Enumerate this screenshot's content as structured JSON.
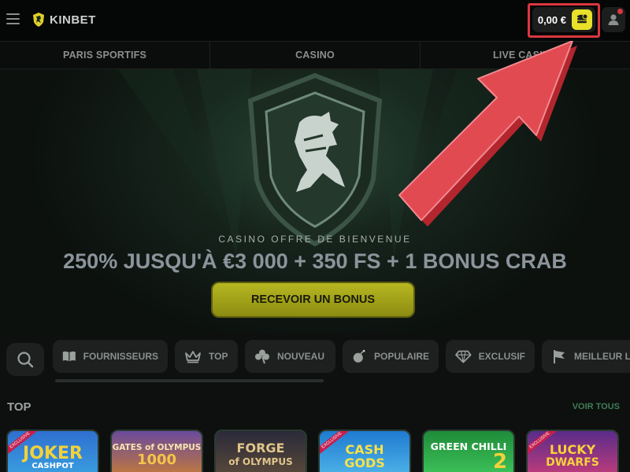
{
  "header": {
    "logo_text": "KINBET",
    "balance": "0,00 €"
  },
  "nav": {
    "items": [
      {
        "label": "PARIS SPORTIFS"
      },
      {
        "label": "CASINO"
      },
      {
        "label": "LIVE CASINO"
      }
    ]
  },
  "hero": {
    "kicker": "CASINO OFFRE DE BIENVENUE",
    "title": "250% JUSQU'À €3 000 + 350 FS + 1 BONUS CRAB",
    "cta_label": "RECEVOIR UN BONUS"
  },
  "filters": {
    "chips": [
      {
        "label": "FOURNISSEURS",
        "icon": "book-icon"
      },
      {
        "label": "TOP",
        "icon": "crown-icon"
      },
      {
        "label": "NOUVEAU",
        "icon": "clover-icon"
      },
      {
        "label": "POPULAIRE",
        "icon": "bomb-icon"
      },
      {
        "label": "EXCLUSIF",
        "icon": "diamond-icon"
      },
      {
        "label": "MEILLEUR L",
        "icon": "flag-icon"
      }
    ]
  },
  "top_section": {
    "title": "TOP",
    "see_all": "VOIR TOUS"
  },
  "games": [
    {
      "title": "JOKER",
      "subtitle": "CASHPOT",
      "tag": "EXCLUSIVE"
    },
    {
      "title": "GATES of OLYMPUS",
      "subtitle": "1000",
      "tag": ""
    },
    {
      "title": "FORGE",
      "subtitle": "of OLYMPUS",
      "tag": ""
    },
    {
      "title": "CASH",
      "subtitle": "GODS",
      "tag": "EXCLUSIVE"
    },
    {
      "title": "GREEN CHILLI",
      "subtitle": "2",
      "tag": ""
    },
    {
      "title": "LUCKY",
      "subtitle": "DWARFS",
      "tag": "EXCLUSIVE"
    }
  ],
  "colors": {
    "accent_yellow": "#e8e02a",
    "highlight_red": "#d9383f",
    "link_green": "#3f7d57"
  }
}
